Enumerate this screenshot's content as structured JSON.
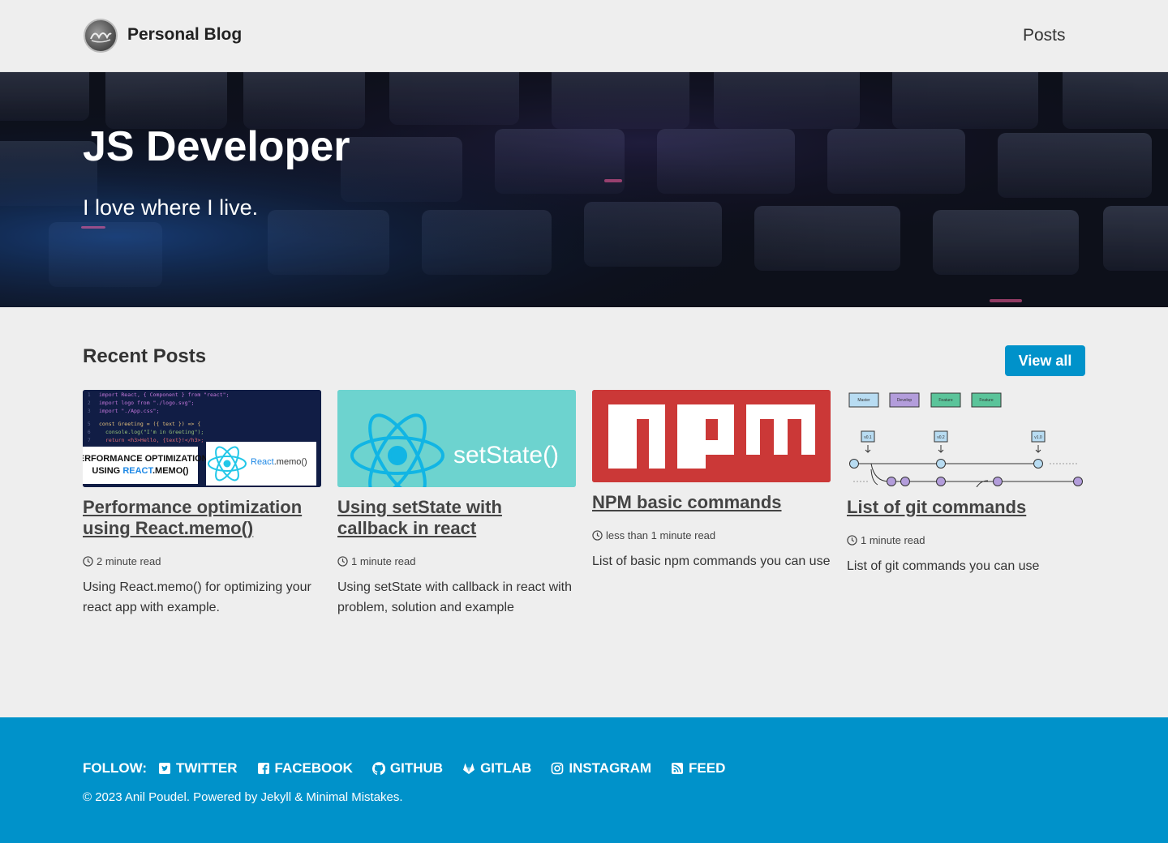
{
  "header": {
    "site_title": "Personal Blog",
    "nav": [
      "Posts"
    ]
  },
  "hero": {
    "title": "JS Developer",
    "tagline": "I love where I live."
  },
  "recent": {
    "heading": "Recent Posts",
    "view_all": "View all"
  },
  "posts": [
    {
      "title": "Performance optimization using React.memo()",
      "read_time": "2 minute read",
      "excerpt": "Using React.memo() for optimizing your react app with example.",
      "thumb_caption": "Performance Optimization using React.memo()",
      "thumb_label": "React.memo()"
    },
    {
      "title": "Using setState with callback in react",
      "read_time": "1 minute read",
      "excerpt": "Using setState with callback in react with problem, solution and example",
      "thumb_label": "setState()"
    },
    {
      "title": "NPM basic commands",
      "read_time": "less than 1 minute read",
      "excerpt": "List of basic npm commands you can use"
    },
    {
      "title": "List of git commands",
      "read_time": "1 minute read",
      "excerpt": "List of git commands you can use",
      "thumb_branches": [
        "Master",
        "Develop",
        "Feature",
        "Feature"
      ],
      "thumb_tags": [
        "v0.1",
        "v0.2",
        "v1.0"
      ]
    }
  ],
  "footer": {
    "follow_label": "FOLLOW:",
    "links": [
      "TWITTER",
      "FACEBOOK",
      "GITHUB",
      "GITLAB",
      "INSTAGRAM",
      "FEED"
    ],
    "copyright": "© 2023 Anil Poudel. Powered by Jekyll & Minimal Mistakes."
  },
  "colors": {
    "accent": "#0092ca",
    "background": "#eeeeee",
    "npm_red": "#cb3837",
    "setstate_teal": "#6dd3cf"
  }
}
